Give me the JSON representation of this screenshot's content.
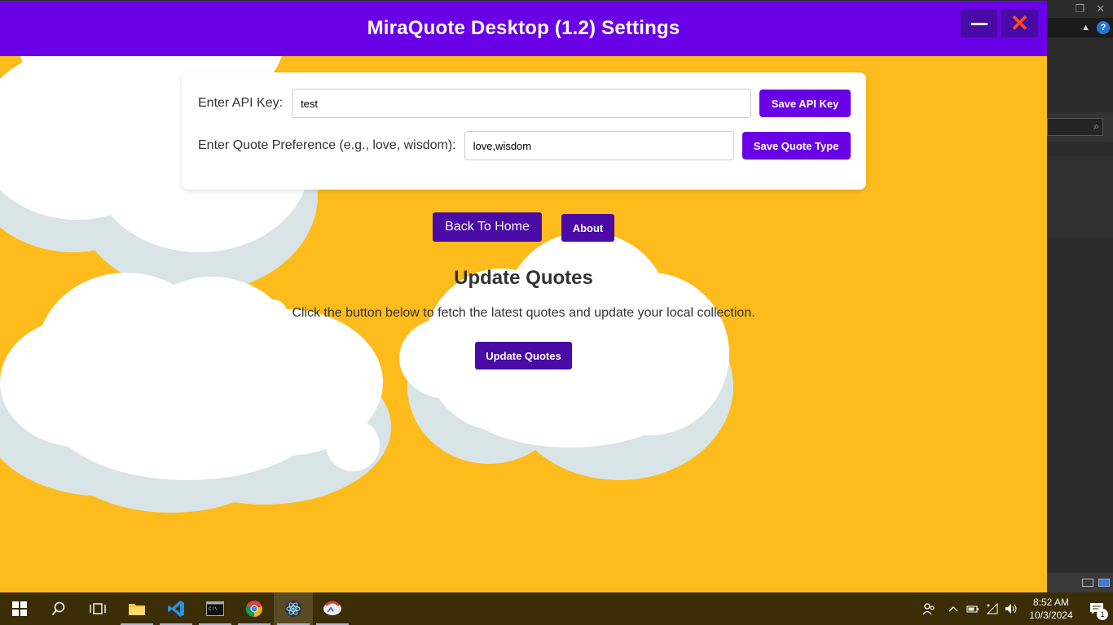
{
  "window": {
    "title": "MiraQuote Desktop (1.2) Settings"
  },
  "settings": {
    "api_key_label": "Enter API Key:",
    "api_key_value": "test",
    "save_api_key_label": "Save API Key",
    "quote_pref_label": "Enter Quote Preference (e.g., love, wisdom):",
    "quote_pref_value": "love,wisdom",
    "save_quote_type_label": "Save Quote Type"
  },
  "nav": {
    "back_home_label": "Back To Home",
    "about_label": "About"
  },
  "update": {
    "title": "Update Quotes",
    "description": "Click the button below to fetch the latest quotes and update your local collection.",
    "button_label": "Update Quotes"
  },
  "taskbar": {
    "apps": [
      "start-icon",
      "search-icon",
      "task-view-icon",
      "file-explorer-icon",
      "vscode-icon",
      "terminal-icon",
      "chrome-icon",
      "electron-icon",
      "miraquote-icon"
    ],
    "time": "8:52 AM",
    "date": "10/3/2024",
    "notification_count": "1"
  },
  "colors": {
    "accent_purple": "#6a00e6",
    "dark_purple": "#4a0aa6",
    "background_yellow": "#fdbc1c"
  }
}
